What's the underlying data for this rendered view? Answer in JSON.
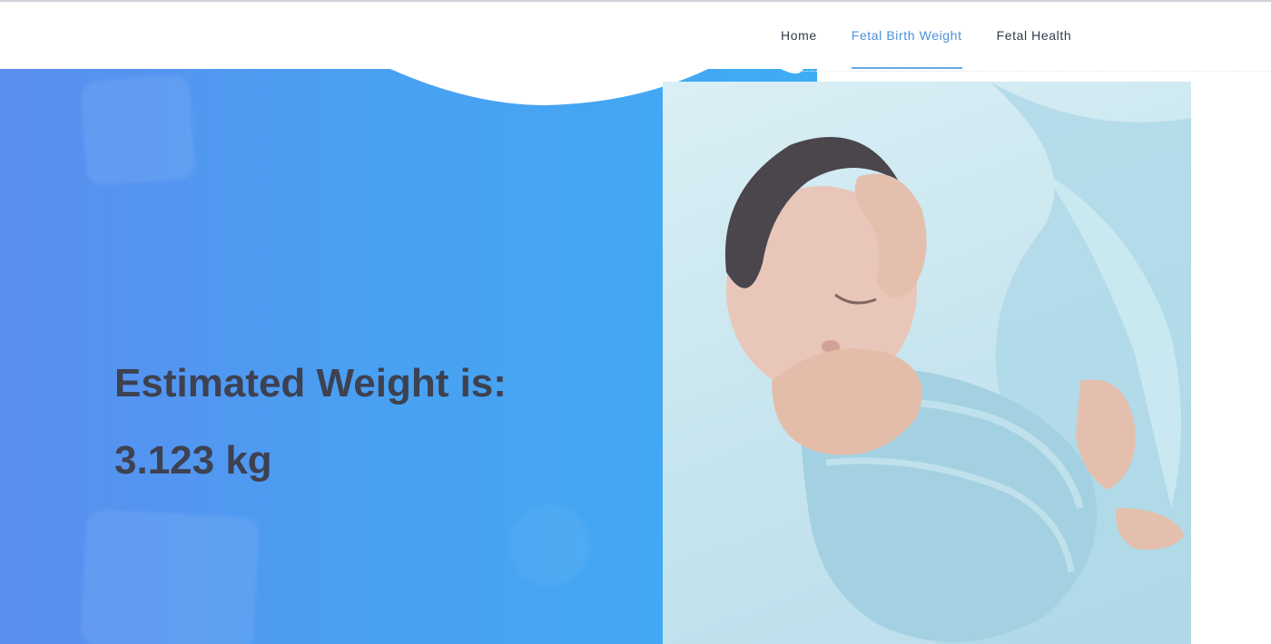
{
  "nav": {
    "items": [
      {
        "label": "Home",
        "active": false
      },
      {
        "label": "Fetal Birth Weight",
        "active": true
      },
      {
        "label": "Fetal Health",
        "active": false
      }
    ]
  },
  "result": {
    "label": "Estimated Weight is:",
    "value": "3.123 kg"
  },
  "colors": {
    "hero_start": "#5a8df0",
    "hero_end": "#3eacf4",
    "nav_active": "#4a90d9",
    "text_dark": "#3d4150"
  },
  "image": {
    "icon": "sleeping-newborn-photo"
  }
}
